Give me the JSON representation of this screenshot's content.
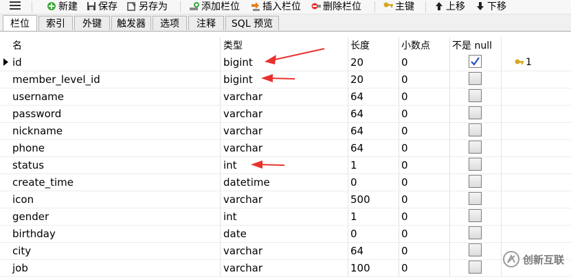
{
  "toolbar": {
    "new_label": "新建",
    "save_label": "保存",
    "save_as_label": "另存为",
    "add_field_label": "添加栏位",
    "insert_field_label": "插入栏位",
    "delete_field_label": "删除栏位",
    "primary_key_label": "主键",
    "move_up_label": "上移",
    "move_down_label": "下移"
  },
  "tabs": [
    "栏位",
    "索引",
    "外键",
    "触发器",
    "选项",
    "注释",
    "SQL 预览"
  ],
  "columns": {
    "name": "名",
    "type": "类型",
    "length": "长度",
    "decimals": "小数点",
    "not_null": "不是 null"
  },
  "rows": [
    {
      "name": "id",
      "type": "bigint",
      "length": "20",
      "decimals": "0",
      "not_null": true,
      "key": "1"
    },
    {
      "name": "member_level_id",
      "type": "bigint",
      "length": "20",
      "decimals": "0",
      "not_null": false
    },
    {
      "name": "username",
      "type": "varchar",
      "length": "64",
      "decimals": "0",
      "not_null": false
    },
    {
      "name": "password",
      "type": "varchar",
      "length": "64",
      "decimals": "0",
      "not_null": false
    },
    {
      "name": "nickname",
      "type": "varchar",
      "length": "64",
      "decimals": "0",
      "not_null": false
    },
    {
      "name": "phone",
      "type": "varchar",
      "length": "64",
      "decimals": "0",
      "not_null": false
    },
    {
      "name": "status",
      "type": "int",
      "length": "1",
      "decimals": "0",
      "not_null": false
    },
    {
      "name": "create_time",
      "type": "datetime",
      "length": "0",
      "decimals": "0",
      "not_null": false
    },
    {
      "name": "icon",
      "type": "varchar",
      "length": "500",
      "decimals": "0",
      "not_null": false
    },
    {
      "name": "gender",
      "type": "int",
      "length": "1",
      "decimals": "0",
      "not_null": false
    },
    {
      "name": "birthday",
      "type": "date",
      "length": "0",
      "decimals": "0",
      "not_null": false
    },
    {
      "name": "city",
      "type": "varchar",
      "length": "64",
      "decimals": "0",
      "not_null": false
    },
    {
      "name": "job",
      "type": "varchar",
      "length": "100",
      "decimals": "0",
      "not_null": false
    }
  ],
  "watermark": {
    "text": "创新互联"
  },
  "colors": {
    "accent_red": "#e8322e",
    "key_gold": "#d9a520",
    "check_blue": "#2a52be"
  }
}
